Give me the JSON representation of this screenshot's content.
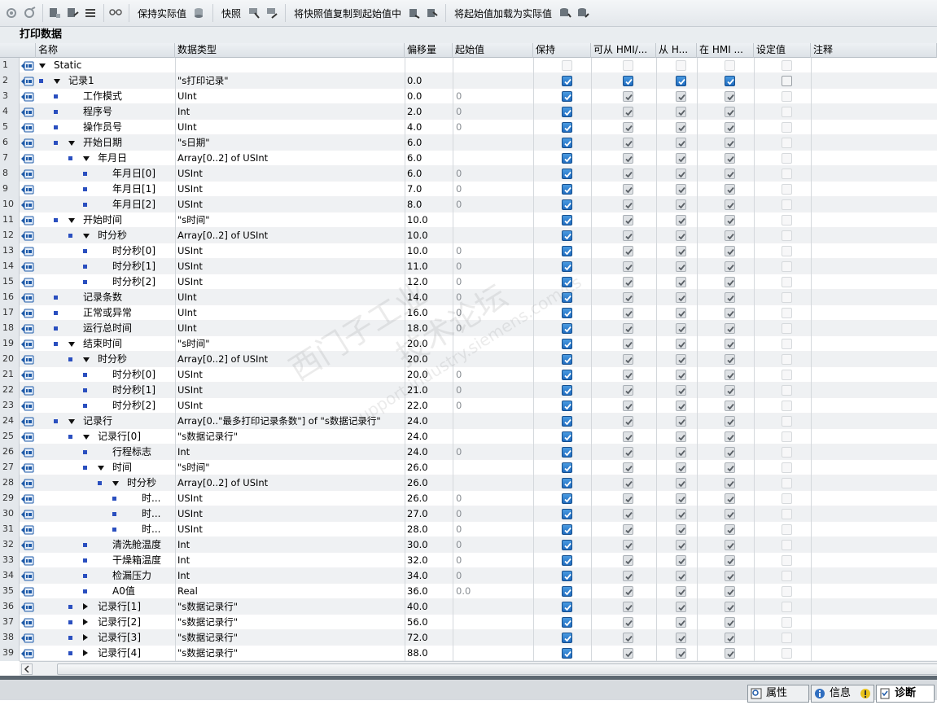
{
  "toolbar": {
    "keep_actual_label": "保持实际值",
    "snapshot_label": "快照",
    "copy_snapshot_label": "将快照值复制到起始值中",
    "load_start_label": "将起始值加载为实际值"
  },
  "title": "打印数据",
  "columns": {
    "name": "名称",
    "type": "数据类型",
    "offset": "偏移量",
    "start": "起始值",
    "retain": "保持",
    "hmi_access": "可从 HMI/...",
    "hmi_write": "从 H...",
    "hmi_visible": "在 HMI ...",
    "setpoint": "设定值",
    "comment": "注释"
  },
  "rows": [
    {
      "num": "1",
      "name": "Static",
      "type": "",
      "offset": "",
      "start": "",
      "level": 0,
      "exp": "down",
      "dot": false,
      "state": "static"
    },
    {
      "num": "2",
      "name": "记录1",
      "type": "\"s打印记录\"",
      "offset": "0.0",
      "start": "",
      "level": 0,
      "exp": "down",
      "dot": true,
      "state": "top"
    },
    {
      "num": "3",
      "name": "工作模式",
      "type": "UInt",
      "offset": "0.0",
      "start": "0",
      "level": 1,
      "exp": "",
      "dot": true,
      "state": "sub"
    },
    {
      "num": "4",
      "name": "程序号",
      "type": "Int",
      "offset": "2.0",
      "start": "0",
      "level": 1,
      "exp": "",
      "dot": true,
      "state": "sub"
    },
    {
      "num": "5",
      "name": "操作员号",
      "type": "UInt",
      "offset": "4.0",
      "start": "0",
      "level": 1,
      "exp": "",
      "dot": true,
      "state": "sub"
    },
    {
      "num": "6",
      "name": "开始日期",
      "type": "\"s日期\"",
      "offset": "6.0",
      "start": "",
      "level": 1,
      "exp": "down",
      "dot": true,
      "state": "sub"
    },
    {
      "num": "7",
      "name": "年月日",
      "type": "Array[0..2] of USInt",
      "offset": "6.0",
      "start": "",
      "level": 2,
      "exp": "down",
      "dot": true,
      "state": "sub"
    },
    {
      "num": "8",
      "name": "年月日[0]",
      "type": "USInt",
      "offset": "6.0",
      "start": "0",
      "level": 3,
      "exp": "",
      "dot": true,
      "state": "sub"
    },
    {
      "num": "9",
      "name": "年月日[1]",
      "type": "USInt",
      "offset": "7.0",
      "start": "0",
      "level": 3,
      "exp": "",
      "dot": true,
      "state": "sub"
    },
    {
      "num": "10",
      "name": "年月日[2]",
      "type": "USInt",
      "offset": "8.0",
      "start": "0",
      "level": 3,
      "exp": "",
      "dot": true,
      "state": "sub"
    },
    {
      "num": "11",
      "name": "开始时间",
      "type": "\"s时间\"",
      "offset": "10.0",
      "start": "",
      "level": 1,
      "exp": "down",
      "dot": true,
      "state": "sub"
    },
    {
      "num": "12",
      "name": "时分秒",
      "type": "Array[0..2] of USInt",
      "offset": "10.0",
      "start": "",
      "level": 2,
      "exp": "down",
      "dot": true,
      "state": "sub"
    },
    {
      "num": "13",
      "name": "时分秒[0]",
      "type": "USInt",
      "offset": "10.0",
      "start": "0",
      "level": 3,
      "exp": "",
      "dot": true,
      "state": "sub"
    },
    {
      "num": "14",
      "name": "时分秒[1]",
      "type": "USInt",
      "offset": "11.0",
      "start": "0",
      "level": 3,
      "exp": "",
      "dot": true,
      "state": "sub"
    },
    {
      "num": "15",
      "name": "时分秒[2]",
      "type": "USInt",
      "offset": "12.0",
      "start": "0",
      "level": 3,
      "exp": "",
      "dot": true,
      "state": "sub"
    },
    {
      "num": "16",
      "name": "记录条数",
      "type": "UInt",
      "offset": "14.0",
      "start": "0",
      "level": 1,
      "exp": "",
      "dot": true,
      "state": "sub"
    },
    {
      "num": "17",
      "name": "正常或异常",
      "type": "UInt",
      "offset": "16.0",
      "start": "0",
      "level": 1,
      "exp": "",
      "dot": true,
      "state": "sub"
    },
    {
      "num": "18",
      "name": "运行总时间",
      "type": "UInt",
      "offset": "18.0",
      "start": "0",
      "level": 1,
      "exp": "",
      "dot": true,
      "state": "sub"
    },
    {
      "num": "19",
      "name": "结束时间",
      "type": "\"s时间\"",
      "offset": "20.0",
      "start": "",
      "level": 1,
      "exp": "down",
      "dot": true,
      "state": "sub"
    },
    {
      "num": "20",
      "name": "时分秒",
      "type": "Array[0..2] of USInt",
      "offset": "20.0",
      "start": "",
      "level": 2,
      "exp": "down",
      "dot": true,
      "state": "sub"
    },
    {
      "num": "21",
      "name": "时分秒[0]",
      "type": "USInt",
      "offset": "20.0",
      "start": "0",
      "level": 3,
      "exp": "",
      "dot": true,
      "state": "sub"
    },
    {
      "num": "22",
      "name": "时分秒[1]",
      "type": "USInt",
      "offset": "21.0",
      "start": "0",
      "level": 3,
      "exp": "",
      "dot": true,
      "state": "sub"
    },
    {
      "num": "23",
      "name": "时分秒[2]",
      "type": "USInt",
      "offset": "22.0",
      "start": "0",
      "level": 3,
      "exp": "",
      "dot": true,
      "state": "sub"
    },
    {
      "num": "24",
      "name": "记录行",
      "type": "Array[0..\"最多打印记录条数\"] of \"s数据记录行\"",
      "offset": "24.0",
      "start": "",
      "level": 1,
      "exp": "down",
      "dot": true,
      "state": "sub"
    },
    {
      "num": "25",
      "name": "记录行[0]",
      "type": "\"s数据记录行\"",
      "offset": "24.0",
      "start": "",
      "level": 2,
      "exp": "down",
      "dot": true,
      "state": "sub"
    },
    {
      "num": "26",
      "name": "行程标志",
      "type": "Int",
      "offset": "24.0",
      "start": "0",
      "level": 3,
      "exp": "",
      "dot": true,
      "state": "sub"
    },
    {
      "num": "27",
      "name": "时间",
      "type": "\"s时间\"",
      "offset": "26.0",
      "start": "",
      "level": 3,
      "exp": "down",
      "dot": true,
      "state": "sub"
    },
    {
      "num": "28",
      "name": "时分秒",
      "type": "Array[0..2] of USInt",
      "offset": "26.0",
      "start": "",
      "level": 4,
      "exp": "down",
      "dot": true,
      "state": "sub"
    },
    {
      "num": "29",
      "name": "时...",
      "type": "USInt",
      "offset": "26.0",
      "start": "0",
      "level": 5,
      "exp": "",
      "dot": true,
      "state": "sub"
    },
    {
      "num": "30",
      "name": "时...",
      "type": "USInt",
      "offset": "27.0",
      "start": "0",
      "level": 5,
      "exp": "",
      "dot": true,
      "state": "sub"
    },
    {
      "num": "31",
      "name": "时...",
      "type": "USInt",
      "offset": "28.0",
      "start": "0",
      "level": 5,
      "exp": "",
      "dot": true,
      "state": "sub"
    },
    {
      "num": "32",
      "name": "清洗舱温度",
      "type": "Int",
      "offset": "30.0",
      "start": "0",
      "level": 3,
      "exp": "",
      "dot": true,
      "state": "sub"
    },
    {
      "num": "33",
      "name": "干燥箱温度",
      "type": "Int",
      "offset": "32.0",
      "start": "0",
      "level": 3,
      "exp": "",
      "dot": true,
      "state": "sub"
    },
    {
      "num": "34",
      "name": "检漏压力",
      "type": "Int",
      "offset": "34.0",
      "start": "0",
      "level": 3,
      "exp": "",
      "dot": true,
      "state": "sub"
    },
    {
      "num": "35",
      "name": "A0值",
      "type": "Real",
      "offset": "36.0",
      "start": "0.0",
      "level": 3,
      "exp": "",
      "dot": true,
      "state": "sub"
    },
    {
      "num": "36",
      "name": "记录行[1]",
      "type": "\"s数据记录行\"",
      "offset": "40.0",
      "start": "",
      "level": 2,
      "exp": "right",
      "dot": true,
      "state": "sub"
    },
    {
      "num": "37",
      "name": "记录行[2]",
      "type": "\"s数据记录行\"",
      "offset": "56.0",
      "start": "",
      "level": 2,
      "exp": "right",
      "dot": true,
      "state": "sub"
    },
    {
      "num": "38",
      "name": "记录行[3]",
      "type": "\"s数据记录行\"",
      "offset": "72.0",
      "start": "",
      "level": 2,
      "exp": "right",
      "dot": true,
      "state": "sub"
    },
    {
      "num": "39",
      "name": "记录行[4]",
      "type": "\"s数据记录行\"",
      "offset": "88.0",
      "start": "",
      "level": 2,
      "exp": "right",
      "dot": true,
      "state": "sub"
    }
  ],
  "bottom_tabs": {
    "properties": "属性",
    "info": "信息",
    "diagnostics": "诊断"
  },
  "watermark": {
    "line1": "西门子工业",
    "line2": "技术论坛",
    "line3": "support.industry.siemens.com/cs"
  },
  "colors": {
    "check_blue": "#2573c9",
    "row_alt": "#eff1f3",
    "dot_blue": "#2a4fbf"
  }
}
